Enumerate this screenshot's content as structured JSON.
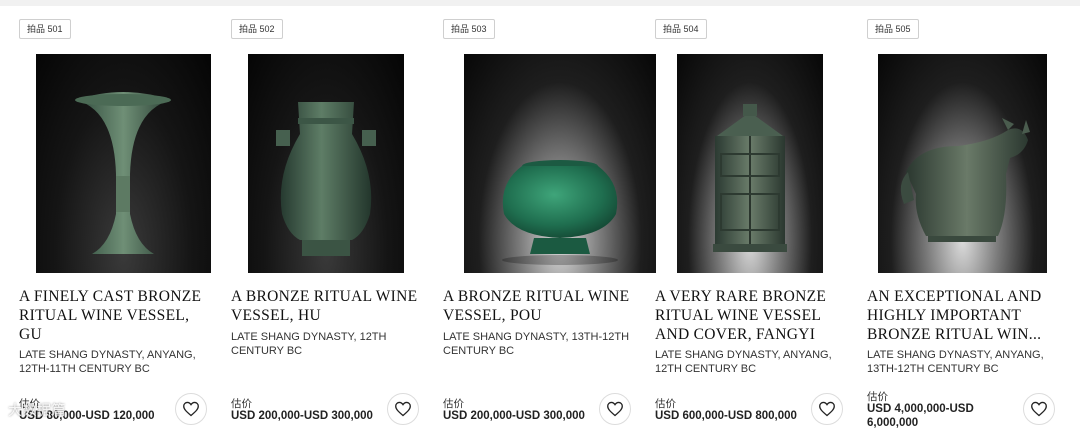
{
  "lots": [
    {
      "badge": "拍品 501",
      "title": "A FINELY CAST BRONZE RITUAL WINE VESSEL, GU",
      "subtitle": "LATE SHANG DYNASTY, ANYANG, 12TH-11TH CENTURY BC",
      "estimate_label": "估价",
      "estimate_value": "USD 80,000-USD 120,000",
      "image_icon": "bronze-gu-vessel",
      "favorite_icon": "heart-outline-icon"
    },
    {
      "badge": "拍品 502",
      "title": "A BRONZE RITUAL WINE VESSEL, HU",
      "subtitle": "LATE SHANG DYNASTY, 12TH CENTURY BC",
      "estimate_label": "估价",
      "estimate_value": "USD 200,000-USD 300,000",
      "image_icon": "bronze-hu-vessel",
      "favorite_icon": "heart-outline-icon"
    },
    {
      "badge": "拍品 503",
      "title": "A BRONZE RITUAL WINE VESSEL, POU",
      "subtitle": "LATE SHANG DYNASTY, 13TH-12TH CENTURY BC",
      "estimate_label": "估价",
      "estimate_value": "USD 200,000-USD 300,000",
      "image_icon": "bronze-pou-vessel",
      "favorite_icon": "heart-outline-icon"
    },
    {
      "badge": "拍品 504",
      "title": "A VERY RARE BRONZE RITUAL WINE VESSEL AND COVER, FANGYI",
      "subtitle": "LATE SHANG DYNASTY, ANYANG, 12TH CENTURY BC",
      "estimate_label": "估价",
      "estimate_value": "USD 600,000-USD 800,000",
      "image_icon": "bronze-fangyi-vessel",
      "favorite_icon": "heart-outline-icon"
    },
    {
      "badge": "拍品 505",
      "title": "AN EXCEPTIONAL AND HIGHLY IMPORTANT BRONZE RITUAL WIN...",
      "subtitle": "LATE SHANG DYNASTY, ANYANG, 13TH-12TH CENTURY BC",
      "estimate_label": "估价",
      "estimate_value": "USD 4,000,000-USD 6,000,000",
      "image_icon": "bronze-gong-vessel",
      "favorite_icon": "heart-outline-icon"
    }
  ],
  "watermark": "大数据篇",
  "colors": {
    "bronze_patina": "#3f6a52",
    "verdigris": "#2f8a62",
    "text_dark": "#111111"
  }
}
